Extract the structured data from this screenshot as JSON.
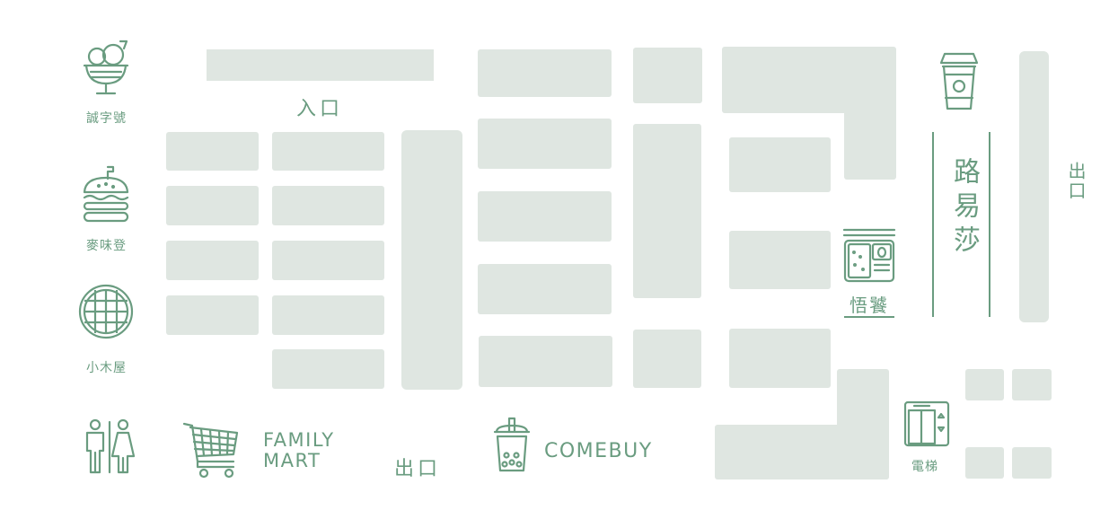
{
  "map": {
    "entrance": "入口",
    "exit_bottom": "出口",
    "exit_right": "出口",
    "shops": {
      "chengzihao": "誠字號",
      "maiweideng": "麥味登",
      "xiaomuwu": "小木屋",
      "family_mart": "FAMILY MART",
      "comebuy": "COMEBUY",
      "wucan": "悟饕",
      "louisa": "路易莎",
      "elevator": "電梯"
    }
  },
  "colors": {
    "block": "#dfe6e1",
    "accent": "#6a9c80",
    "background": "#ffffff"
  },
  "icons": [
    "ice-cream-icon",
    "burger-icon",
    "waffle-icon",
    "restroom-icon",
    "shopping-cart-icon",
    "bubble-tea-icon",
    "coffee-cup-icon",
    "bento-box-icon",
    "elevator-icon"
  ]
}
